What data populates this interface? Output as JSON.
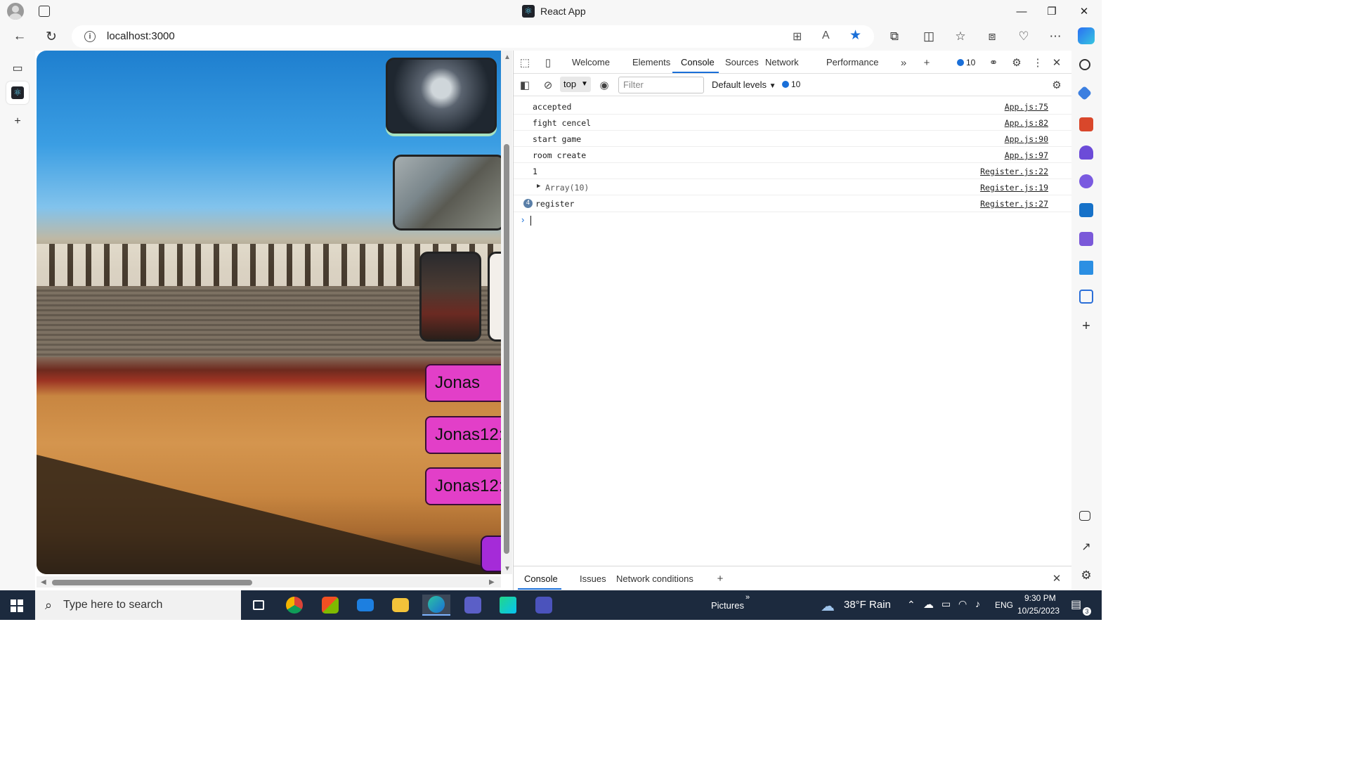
{
  "window": {
    "title": "React App",
    "controls": [
      "—",
      "❐",
      "✕"
    ]
  },
  "address_bar": {
    "url": "localhost:3000"
  },
  "page": {
    "player_names": [
      "Jonas",
      "Jonas12:",
      "Jonas12:"
    ]
  },
  "devtools": {
    "tabs": [
      "Welcome",
      "Elements",
      "Console",
      "Sources",
      "Network",
      "Performance"
    ],
    "active_tab": "Console",
    "message_count": "10",
    "context": "top",
    "filter_placeholder": "Filter",
    "levels": "Default levels",
    "log": [
      {
        "message": "accepted",
        "source": "App.js:75"
      },
      {
        "message": "fight cencel",
        "source": "App.js:82"
      },
      {
        "message": "start game",
        "source": "App.js:90"
      },
      {
        "message": "room create",
        "source": "App.js:97"
      },
      {
        "message": "1",
        "source": "Register.js:22"
      },
      {
        "message": "Array(10)",
        "source": "Register.js:19"
      },
      {
        "message": "register",
        "source": "Register.js:27",
        "count": "4"
      }
    ],
    "drawer_tabs": [
      "Console",
      "Issues",
      "Network conditions"
    ]
  },
  "taskbar": {
    "search_placeholder": "Type here to search",
    "pictures_label": "Pictures",
    "weather": "38°F  Rain",
    "language": "ENG",
    "time": "9:30 PM",
    "date": "10/25/2023",
    "notification_count": "3"
  },
  "colors": {
    "accent": "#1a6fd8",
    "name_button": "#e23fc8",
    "purple_button": "#a52bd8",
    "taskbar": "#1c2a3e"
  }
}
